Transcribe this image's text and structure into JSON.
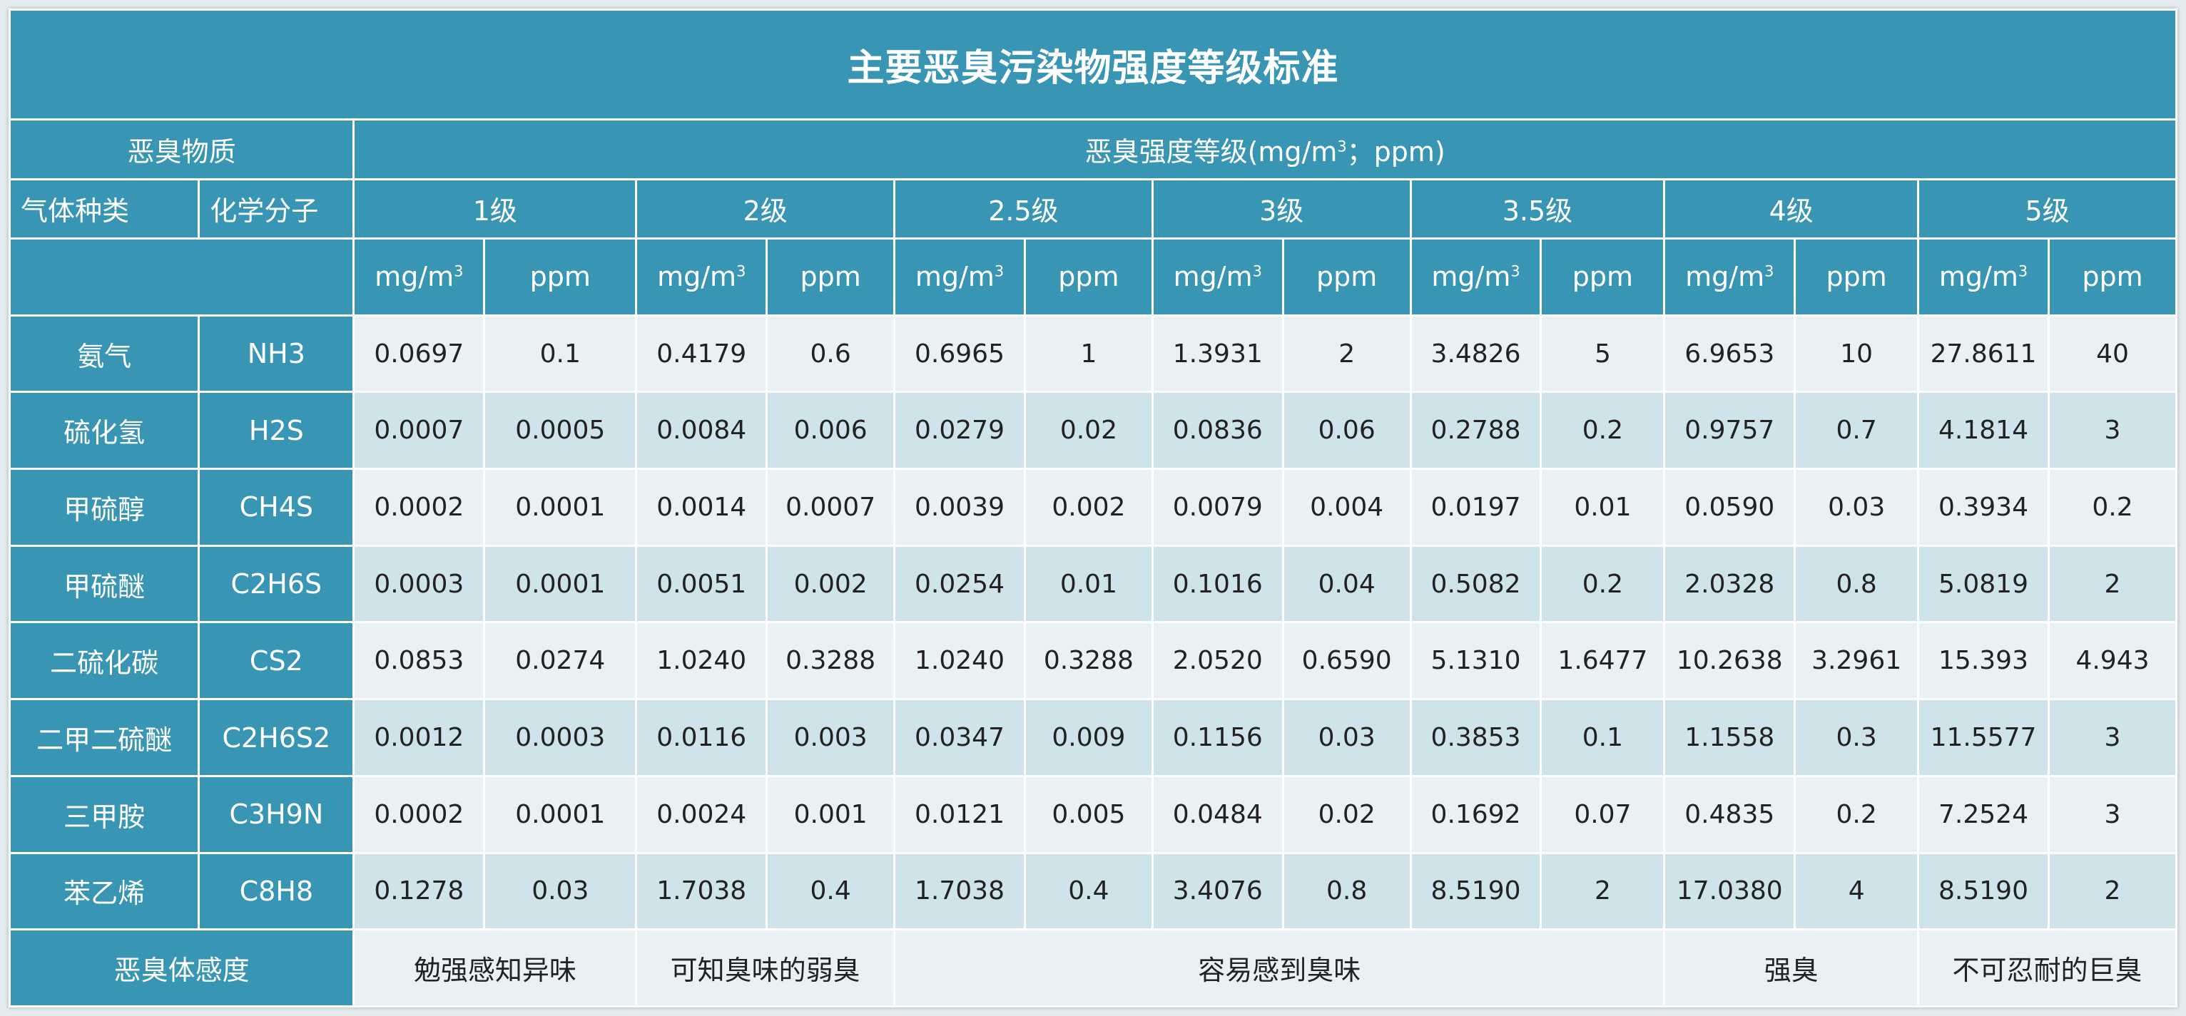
{
  "title": "主要恶臭污染物强度等级标准",
  "header": {
    "substance": "恶臭物质",
    "intensity_prefix": "恶臭强度等级(mg/m",
    "intensity_sup": "3",
    "intensity_suffix": "；ppm)",
    "gas_type": "气体种类",
    "formula": "化学分子",
    "levels": [
      "1级",
      "2级",
      "2.5级",
      "3级",
      "3.5级",
      "4级",
      "5级"
    ],
    "unit_mg": "mg/m",
    "unit_mg_sup": "3",
    "unit_ppm": "ppm"
  },
  "rows": [
    {
      "name": "氨气",
      "formula": "NH3",
      "values": [
        "0.0697",
        "0.1",
        "0.4179",
        "0.6",
        "0.6965",
        "1",
        "1.3931",
        "2",
        "3.4826",
        "5",
        "6.9653",
        "10",
        "27.8611",
        "40"
      ]
    },
    {
      "name": "硫化氢",
      "formula": "H2S",
      "values": [
        "0.0007",
        "0.0005",
        "0.0084",
        "0.006",
        "0.0279",
        "0.02",
        "0.0836",
        "0.06",
        "0.2788",
        "0.2",
        "0.9757",
        "0.7",
        "4.1814",
        "3"
      ]
    },
    {
      "name": "甲硫醇",
      "formula": "CH4S",
      "values": [
        "0.0002",
        "0.0001",
        "0.0014",
        "0.0007",
        "0.0039",
        "0.002",
        "0.0079",
        "0.004",
        "0.0197",
        "0.01",
        "0.0590",
        "0.03",
        "0.3934",
        "0.2"
      ]
    },
    {
      "name": "甲硫醚",
      "formula": "C2H6S",
      "values": [
        "0.0003",
        "0.0001",
        "0.0051",
        "0.002",
        "0.0254",
        "0.01",
        "0.1016",
        "0.04",
        "0.5082",
        "0.2",
        "2.0328",
        "0.8",
        "5.0819",
        "2"
      ]
    },
    {
      "name": "二硫化碳",
      "formula": "CS2",
      "values": [
        "0.0853",
        "0.0274",
        "1.0240",
        "0.3288",
        "1.0240",
        "0.3288",
        "2.0520",
        "0.6590",
        "5.1310",
        "1.6477",
        "10.2638",
        "3.2961",
        "15.393",
        "4.943"
      ]
    },
    {
      "name": "二甲二硫醚",
      "formula": "C2H6S2",
      "values": [
        "0.0012",
        "0.0003",
        "0.0116",
        "0.003",
        "0.0347",
        "0.009",
        "0.1156",
        "0.03",
        "0.3853",
        "0.1",
        "1.1558",
        "0.3",
        "11.5577",
        "3"
      ]
    },
    {
      "name": "三甲胺",
      "formula": "C3H9N",
      "values": [
        "0.0002",
        "0.0001",
        "0.0024",
        "0.001",
        "0.0121",
        "0.005",
        "0.0484",
        "0.02",
        "0.1692",
        "0.07",
        "0.4835",
        "0.2",
        "7.2524",
        "3"
      ]
    },
    {
      "name": "苯乙烯",
      "formula": "C8H8",
      "values": [
        "0.1278",
        "0.03",
        "1.7038",
        "0.4",
        "1.7038",
        "0.4",
        "3.4076",
        "0.8",
        "8.5190",
        "2",
        "17.0380",
        "4",
        "8.5190",
        "2"
      ]
    }
  ],
  "footer": {
    "label": "恶臭体感度",
    "perceptions": [
      {
        "text": "勉强感知异味",
        "span": 2
      },
      {
        "text": "可知臭味的弱臭",
        "span": 2
      },
      {
        "text": "容易感到臭味",
        "span": 6
      },
      {
        "text": "强臭",
        "span": 2
      },
      {
        "text": "不可忍耐的巨臭",
        "span": 2
      }
    ]
  },
  "colors": {
    "header_bg": "#3895b4",
    "row_light": "#e9f1f4",
    "row_dark": "#cfe3ea",
    "border": "#ffffff"
  }
}
